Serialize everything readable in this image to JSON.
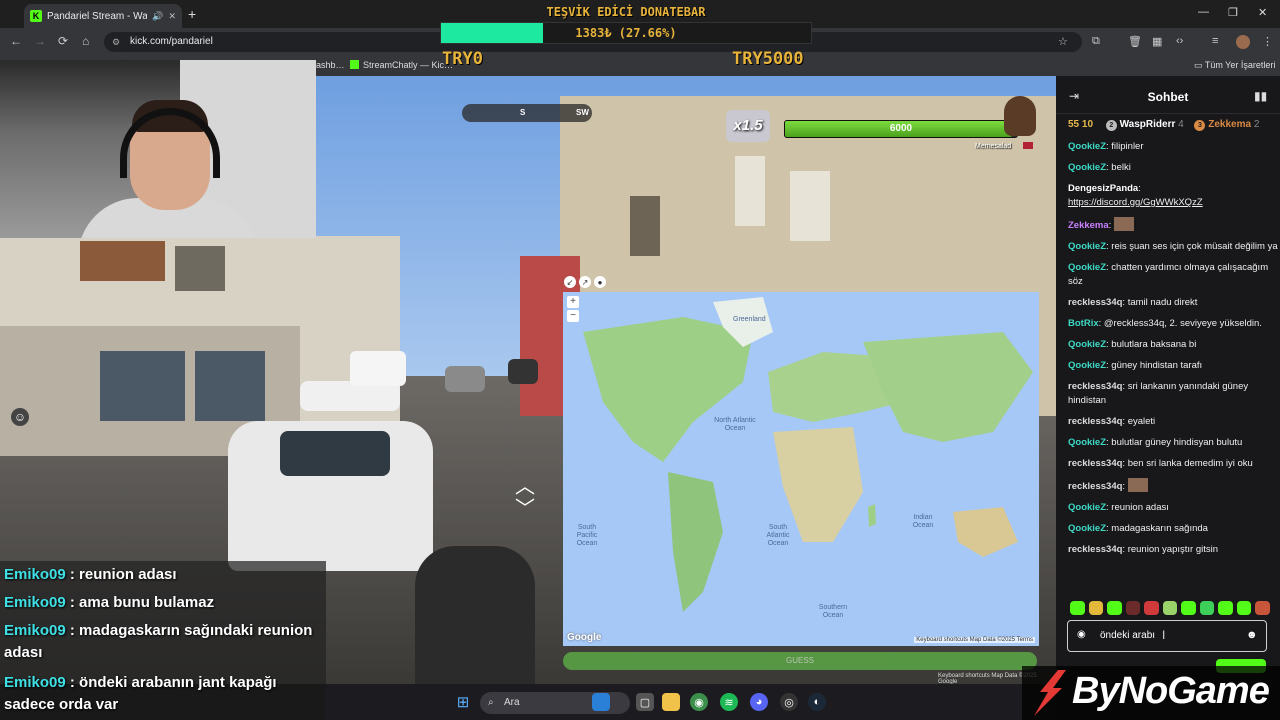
{
  "browser": {
    "tab_title": "Pandariel Stream - Watch Li",
    "tab_favicon": "K",
    "url": "kick.com/pandariel",
    "bookmarks": [
      "ashb…",
      "StreamChatly — Kic…",
      "Tüm Yer İşaretleri"
    ]
  },
  "donation": {
    "title": "TEŞVİK EDİCİ DONATEBAR",
    "progress_text": "1383₺ (27.66%)",
    "progress_fraction": 0.2766,
    "min_label": "TRY0",
    "max_label": "TRY5000",
    "colors": {
      "fill": "#1de9a0",
      "text": "#e7b33a"
    }
  },
  "game": {
    "compass_s": "S",
    "compass_sw": "SW",
    "multiplier": "x1.5",
    "health": "6000",
    "health_fraction": 0.98,
    "player_name": "Memesalad",
    "guess_label": "GUESS",
    "footer": "Keyboard shortcuts  Map Data ©2025 Google"
  },
  "map": {
    "oceans": [
      {
        "name": "North Atlantic Ocean"
      },
      {
        "name": "South Pacific Ocean"
      },
      {
        "name": "South Atlantic Ocean"
      },
      {
        "name": "Indian Ocean"
      },
      {
        "name": "Southern Ocean"
      }
    ],
    "places": [
      "Greenland"
    ],
    "logo": "Google",
    "footer": "Keyboard shortcuts  Map Data ©2025  Terms"
  },
  "overlay_chat": [
    {
      "user": "Emiko09",
      "text": "reunion adası"
    },
    {
      "user": "Emiko09",
      "text": "ama bunu bulamaz"
    },
    {
      "user": "Emiko09",
      "text": "madagaskarın sağındaki reunion adası"
    },
    {
      "user": "Emiko09",
      "text": "öndeki arabanın jant kapağı sadece orda var"
    }
  ],
  "taskbar": {
    "search_placeholder": "Ara"
  },
  "chat": {
    "title": "Sohbet",
    "leaderboard": [
      {
        "rank": "",
        "name": "",
        "count": "55 10"
      },
      {
        "rank": "2",
        "name": "WaspRiderr",
        "count": "4"
      },
      {
        "rank": "3",
        "name": "Zekkema",
        "count": "2"
      }
    ],
    "messages": [
      {
        "user": "QookieZ",
        "color": "#3dd9c4",
        "text": "filipinler"
      },
      {
        "user": "QookieZ",
        "color": "#3dd9c4",
        "text": "belki"
      },
      {
        "user": "DengesizPanda",
        "color": "#ffffff",
        "text": "https://discord.gg/GgWWkXQzZ"
      },
      {
        "user": "Zekkema",
        "color": "#c980ff",
        "text": ""
      },
      {
        "user": "QookieZ",
        "color": "#3dd9c4",
        "text": "reis şuan ses için çok müsait değilim ya"
      },
      {
        "user": "QookieZ",
        "color": "#3dd9c4",
        "text": "chatten yardımcı olmaya çalışacağım söz"
      },
      {
        "user": "reckless34q",
        "color": "#dcdcdc",
        "text": "tamil nadu direkt"
      },
      {
        "user": "BotRix",
        "color": "#3dd9c4",
        "text": "@reckless34q, 2. seviyeye yükseldin."
      },
      {
        "user": "QookieZ",
        "color": "#3dd9c4",
        "text": "bulutlara baksana bi"
      },
      {
        "user": "QookieZ",
        "color": "#3dd9c4",
        "text": "güney hindistan tarafı"
      },
      {
        "user": "reckless34q",
        "color": "#dcdcdc",
        "text": "sri lankanın yanındaki güney hindistan"
      },
      {
        "user": "reckless34q",
        "color": "#dcdcdc",
        "text": "eyaleti"
      },
      {
        "user": "QookieZ",
        "color": "#3dd9c4",
        "text": "bulutlar güney hindisyan bulutu"
      },
      {
        "user": "reckless34q",
        "color": "#dcdcdc",
        "text": "ben sri lanka demedim iyi oku"
      },
      {
        "user": "reckless34q",
        "color": "#dcdcdc",
        "text": ""
      },
      {
        "user": "QookieZ",
        "color": "#3dd9c4",
        "text": "reunion adası"
      },
      {
        "user": "QookieZ",
        "color": "#3dd9c4",
        "text": "madagaskarın sağında"
      },
      {
        "user": "reckless34q",
        "color": "#dcdcdc",
        "text": "reunion yapıştır gitsin"
      }
    ],
    "input_value": "öndeki arabı"
  },
  "watermark": "ByNoGame"
}
